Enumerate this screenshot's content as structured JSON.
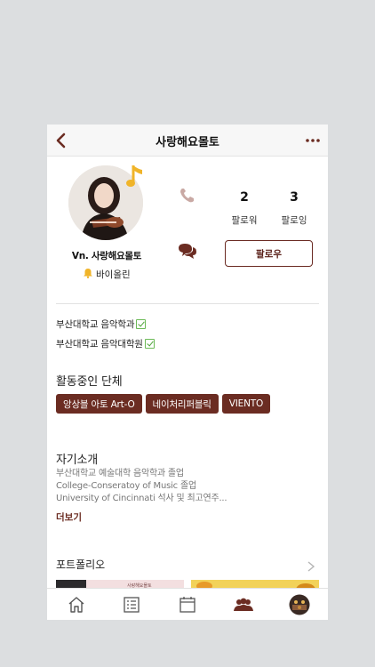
{
  "header": {
    "title": "사랑해요몰토"
  },
  "profile": {
    "name": "Vn. 사랑해요몰토",
    "instrument": "바이올린",
    "followers_count": "2",
    "followers_label": "팔로워",
    "following_count": "3",
    "following_label": "팔로잉",
    "follow_button": "팔로우"
  },
  "education": [
    {
      "label": "부산대학교 음악학과"
    },
    {
      "label": "부산대학교 음악대학원"
    }
  ],
  "groups": {
    "title": "활동중인 단체",
    "items": [
      "앙상블 아토 Art-O",
      "네이처리퍼블릭",
      "VIENTO"
    ]
  },
  "intro": {
    "title": "자기소개",
    "lines": [
      "부산대학교 예술대학 음악학과 졸업",
      "College-Conseratoy of Music 졸업",
      "University of Cincinnati 석사 및 최고연주..."
    ],
    "more_label": "더보기"
  },
  "portfolio": {
    "title": "포트폴리오",
    "thumb1_caption": "사랑해요몰토"
  },
  "colors": {
    "accent": "#6b2c22",
    "check": "#4fa33a",
    "note": "#f0b429"
  },
  "tabbar": {
    "items": [
      "home-icon",
      "list-icon",
      "calendar-icon",
      "people-icon",
      "profile-avatar"
    ]
  }
}
